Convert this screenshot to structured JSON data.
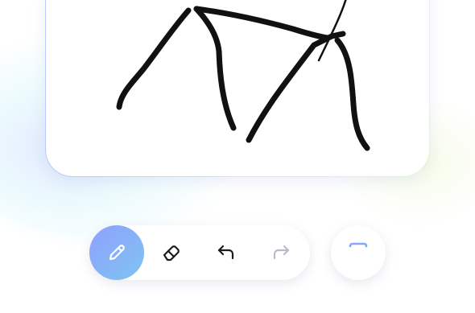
{
  "canvas": {
    "content": "freehand-drawing"
  },
  "toolbar": {
    "active_tool": "pen",
    "tools": [
      {
        "id": "pen",
        "icon": "pencil-icon",
        "active": true
      },
      {
        "id": "eraser",
        "icon": "eraser-icon",
        "active": false
      },
      {
        "id": "undo",
        "icon": "undo-arrow-icon",
        "enabled": true
      },
      {
        "id": "redo",
        "icon": "redo-arrow-icon",
        "enabled": false
      }
    ]
  },
  "text_tool": {
    "icon": "text-t-icon"
  },
  "colors": {
    "accent_start": "#8fa0ff",
    "accent_end": "#7fc4f0",
    "stroke": "#111111",
    "icon_default": "#1c1c1c",
    "icon_disabled": "#b8bcc6"
  }
}
